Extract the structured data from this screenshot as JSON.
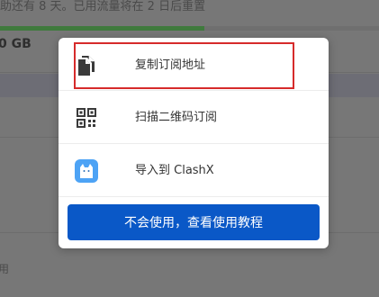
{
  "background": {
    "top_text": "助还有 8 天。已用流量将在 2 日后重置",
    "progress_fraction": 0.54,
    "size_text": "0 GB",
    "bottom_text": "用"
  },
  "modal": {
    "options": [
      {
        "label": "复制订阅地址",
        "icon": "copy-icon",
        "highlighted": true
      },
      {
        "label": "扫描二维码订阅",
        "icon": "qr-code-icon",
        "highlighted": false
      },
      {
        "label": "导入到 ClashX",
        "icon": "clashx-cat-icon",
        "highlighted": false
      }
    ],
    "help_button_label": "不会使用，查看使用教程"
  },
  "colors": {
    "accent": "#0a58c7",
    "highlight_border": "#d62b2b",
    "overlay": "#777777"
  }
}
